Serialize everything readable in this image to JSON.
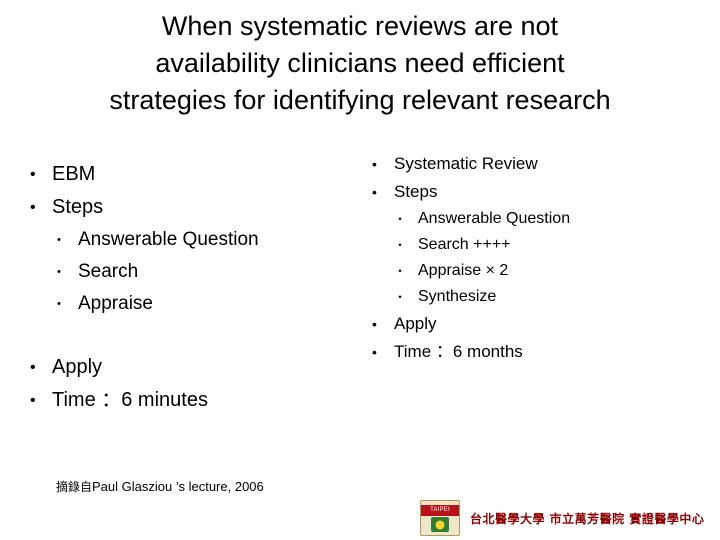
{
  "slide": {
    "title_lines": [
      "When systematic reviews are not",
      "availability clinicians need efficient",
      "strategies for identifying relevant research"
    ],
    "left_column": {
      "items": [
        {
          "level": 1,
          "text": "EBM"
        },
        {
          "level": 1,
          "text": "Steps"
        },
        {
          "level": 2,
          "text": "Answerable Question"
        },
        {
          "level": 2,
          "text": "Search"
        },
        {
          "level": 2,
          "text": "Appraise"
        },
        {
          "level": 1,
          "text": "Apply"
        },
        {
          "level": 1,
          "text": "Time ：6 minutes"
        }
      ]
    },
    "right_column": {
      "items": [
        {
          "level": 1,
          "text": "Systematic Review"
        },
        {
          "level": 1,
          "text": "Steps"
        },
        {
          "level": 2,
          "text": "Answerable Question"
        },
        {
          "level": 2,
          "text": "Search ++++"
        },
        {
          "level": 2,
          "text": "Appraise × 2"
        },
        {
          "level": 2,
          "text": "Synthesize"
        },
        {
          "level": 1,
          "text": "Apply"
        },
        {
          "level": 1,
          "text": "Time ：6 months"
        }
      ]
    },
    "credit": {
      "prefix": "摘錄自",
      "text": "Paul Glasziou ’s lecture, 2006"
    },
    "footer": {
      "logo_band_text": "TAIPEI",
      "text": "台北醫學大學 市立萬芳醫院 實證醫學中心"
    }
  }
}
